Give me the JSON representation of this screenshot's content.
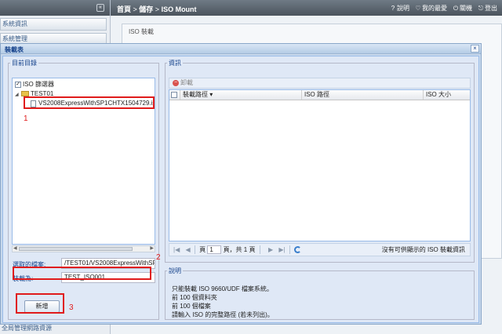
{
  "background": {
    "sidebar_items": [
      "系統資訊",
      "系統管理",
      "",
      "",
      ""
    ],
    "sidebar_bottom": "全局管理網路資源",
    "breadcrumb": {
      "home": "首頁",
      "sep1": " > ",
      "storage": "儲存",
      "sep2": " > ",
      "page": "ISO Mount"
    },
    "top_links": {
      "help": "說明",
      "favorites": "我的最愛",
      "shutdown": "關機",
      "logout": "登出"
    },
    "panel_title": "ISO 裝載"
  },
  "dialog": {
    "title": "裝載表",
    "close": "×",
    "directory": {
      "legend": "目前目錄",
      "tree": {
        "root_label": "ISO 篩選器",
        "folder_label": "TEST01",
        "file_label": "VS2008ExpressWithSP1CHTX1504729.iso"
      },
      "selected_file_label": "選取的檔案:",
      "selected_file_value": "/TEST01/VS2008ExpressWithSP1CHTX1504729.iso",
      "mount_as_label": "裝載為:",
      "mount_as_value": "TEST_ISO001",
      "add_button": "新增"
    },
    "info": {
      "legend": "資訊",
      "unmount_button": "卸載",
      "columns": [
        "裝載路徑 ▾",
        "ISO 路徑",
        "ISO 大小"
      ],
      "pager": {
        "page_label": "頁",
        "page_value": "1",
        "page_total": "頁，共 1 頁",
        "message": "沒有可供顯示的 ISO 裝載資訊"
      }
    },
    "description": {
      "legend": "說明",
      "lines": [
        "只能裝載 ISO 9660/UDF 檔案系統。",
        "前 100 個資料夾",
        "前 100 個檔案",
        "請輸入 ISO 的完整路徑 (若未列出)。"
      ]
    }
  },
  "annotations": {
    "n1": "1",
    "n2": "2",
    "n3": "3"
  },
  "colors": {
    "highlight": "#e01b1b",
    "accent": "#15428b"
  }
}
